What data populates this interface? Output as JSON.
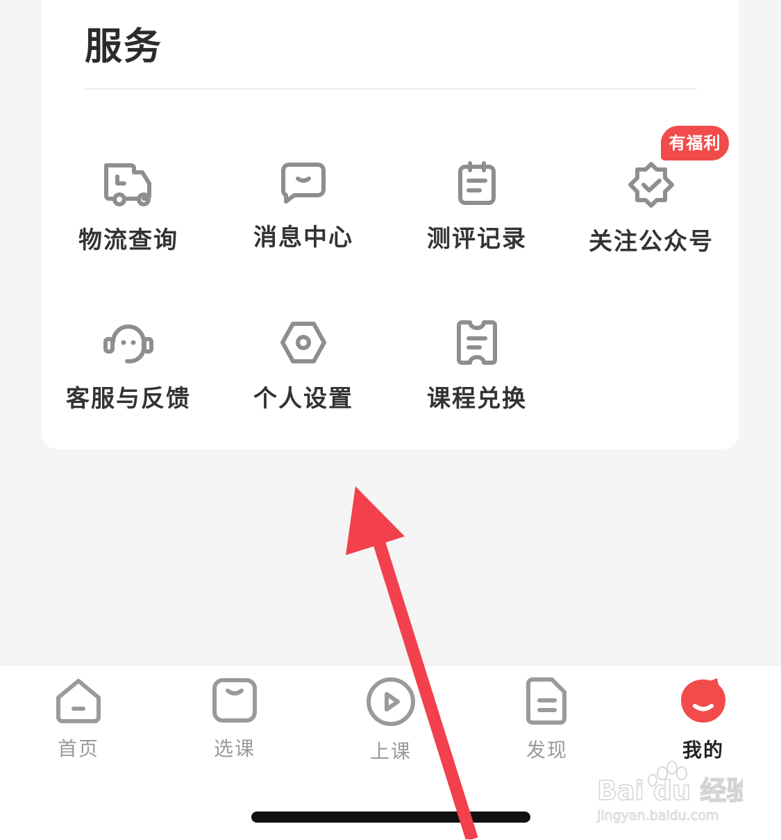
{
  "services": {
    "title": "服务",
    "items": [
      {
        "label": "物流查询",
        "icon": "truck-icon"
      },
      {
        "label": "消息中心",
        "icon": "message-icon"
      },
      {
        "label": "测评记录",
        "icon": "clipboard-icon"
      },
      {
        "label": "关注公众号",
        "icon": "verified-badge-icon",
        "badge": "有福利"
      },
      {
        "label": "客服与反馈",
        "icon": "headset-icon"
      },
      {
        "label": "个人设置",
        "icon": "settings-hexagon-icon"
      },
      {
        "label": "课程兑换",
        "icon": "ticket-icon"
      }
    ]
  },
  "tabbar": {
    "items": [
      {
        "label": "首页",
        "icon": "home-icon"
      },
      {
        "label": "选课",
        "icon": "bag-icon"
      },
      {
        "label": "上课",
        "icon": "play-icon"
      },
      {
        "label": "发现",
        "icon": "document-icon"
      },
      {
        "label": "我的",
        "icon": "profile-blob-icon",
        "active": true
      }
    ]
  },
  "watermark": {
    "text": "Bai du 经验",
    "url_text": "jingyan.baidu.com"
  },
  "colors": {
    "accent": "#f24b4b",
    "icon_gray": "#8e8e8e",
    "arrow": "#f2404c"
  }
}
